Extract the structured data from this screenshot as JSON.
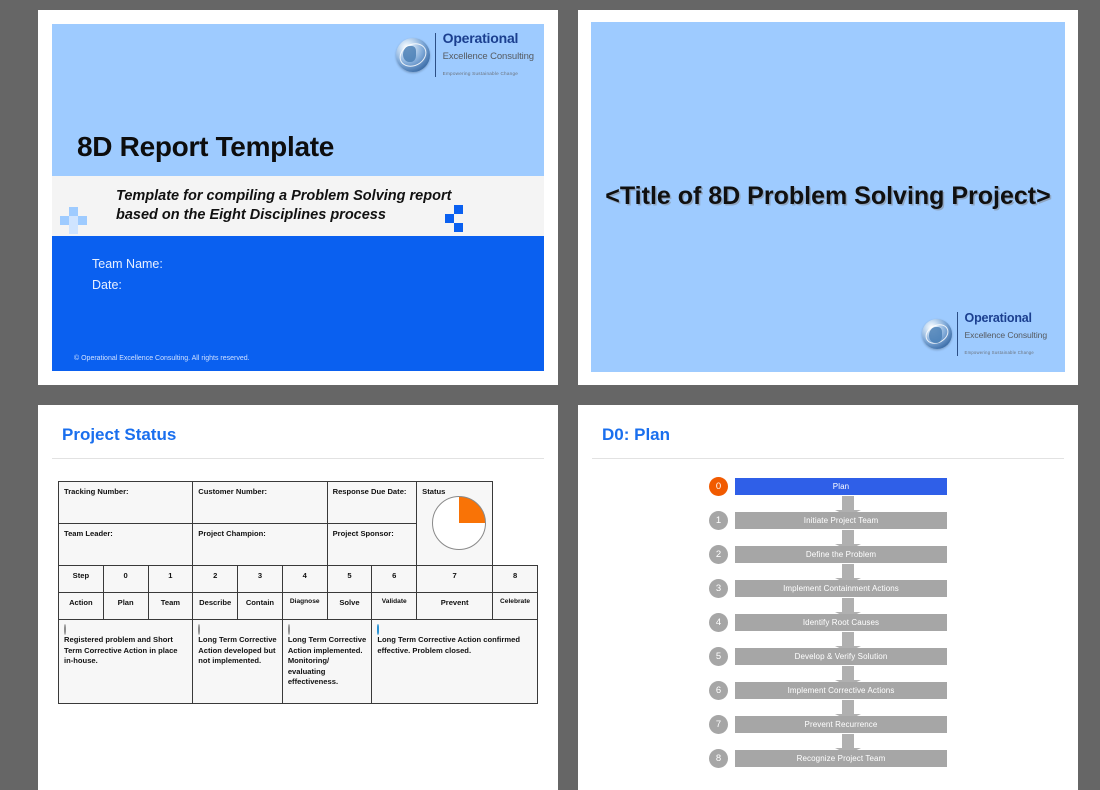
{
  "brand": {
    "logo_line1": "Operational",
    "logo_line2": "Excellence Consulting",
    "logo_tagline": "Empowering Sustainable Change",
    "accent_blue": "#1a6fee",
    "hero_blue": "#9ecbff",
    "body_blue": "#0a60f0",
    "accent_orange": "#f15a00"
  },
  "slide1": {
    "title": "8D Report Template",
    "subtitle_line1": "Template for compiling a Problem Solving report",
    "subtitle_line2": "based on the Eight Disciplines process",
    "field_team": "Team Name:",
    "field_date": "Date:",
    "copyright": "© Operational Excellence Consulting.  All rights reserved."
  },
  "slide2": {
    "title": "<Title of 8D Problem Solving Project>"
  },
  "slide3": {
    "heading": "Project Status",
    "info_fields": [
      "Tracking Number:",
      "Customer Number:",
      "Response Due Date:",
      "Team Leader:",
      "Project Champion:",
      "Project Sponsor:"
    ],
    "status_label": "Status",
    "status_pie_percent": 25,
    "step_header": "Step",
    "step_numbers": [
      "0",
      "1",
      "2",
      "3",
      "4",
      "5",
      "6",
      "7",
      "8"
    ],
    "action_header": "Action",
    "actions": [
      "Plan",
      "Team",
      "Describe",
      "Contain",
      "Diagnose",
      "Solve",
      "Validate",
      "Prevent",
      "Celebrate"
    ],
    "legend": [
      {
        "percent": 25,
        "color": "#f97306",
        "text": "Registered problem and Short Term Corrective Action in place in-house."
      },
      {
        "percent": 50,
        "color": "#f5b500",
        "text": "Long Term Corrective Action developed but not implemented."
      },
      {
        "percent": 75,
        "color": "#5b7c2a",
        "text": "Long Term Corrective Action implemented. Monitoring/ evaluating effectiveness."
      },
      {
        "percent": 100,
        "color": "#2a92d4",
        "text": "Long Term Corrective Action confirmed effective. Problem closed."
      }
    ]
  },
  "slide4": {
    "heading": "D0: Plan",
    "steps": [
      {
        "num": "0",
        "label": "Plan",
        "active": true
      },
      {
        "num": "1",
        "label": "Initiate Project Team",
        "active": false
      },
      {
        "num": "2",
        "label": "Define the Problem",
        "active": false
      },
      {
        "num": "3",
        "label": "Implement Containment Actions",
        "active": false
      },
      {
        "num": "4",
        "label": "Identify Root Causes",
        "active": false
      },
      {
        "num": "5",
        "label": "Develop & Verify Solution",
        "active": false
      },
      {
        "num": "6",
        "label": "Implement Corrective Actions",
        "active": false
      },
      {
        "num": "7",
        "label": "Prevent Recurrence",
        "active": false
      },
      {
        "num": "8",
        "label": "Recognize Project Team",
        "active": false
      }
    ]
  }
}
